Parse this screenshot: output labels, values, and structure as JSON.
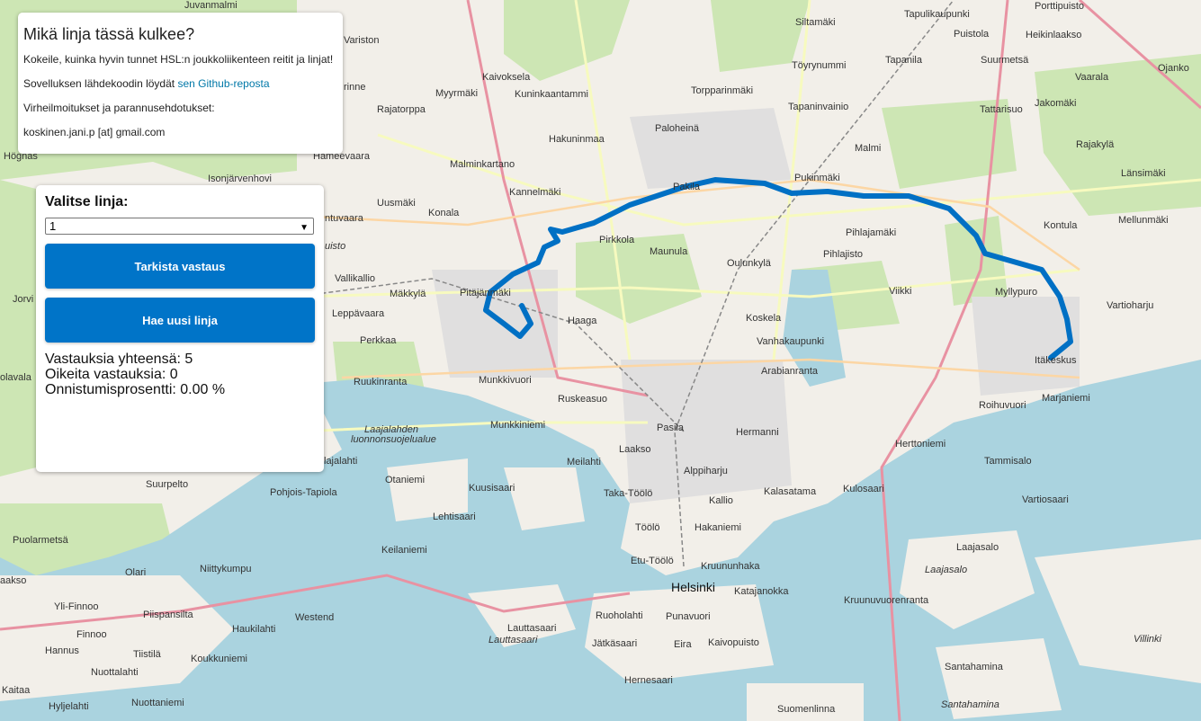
{
  "info": {
    "title": "Mikä linja tässä kulkee?",
    "intro": "Kokeile, kuinka hyvin tunnet HSL:n joukkoliikenteen reitit ja linjat!",
    "source_prefix": "Sovelluksen lähdekoodin löydät ",
    "source_link": "sen Github-reposta",
    "feedback_label": "Virheilmoitukset ja parannusehdotukset:",
    "email": "koskinen.jani.p [at] gmail.com"
  },
  "game": {
    "select_label": "Valitse linja:",
    "selected_line": "1",
    "check_button": "Tarkista vastaus",
    "new_button": "Hae uusi linja",
    "stats": {
      "total": "Vastauksia yhteensä: 5",
      "correct": "Oikeita vastauksia: 0",
      "percent": "Onnistumisprosentti: 0.00 %"
    }
  },
  "map": {
    "route_color": "#0070c4",
    "labels": [
      {
        "id": "juvanmalmi",
        "text": "Juvanmalmi"
      },
      {
        "id": "variston",
        "text": "Variston"
      },
      {
        "id": "kaivoksela",
        "text": "Kaivoksela"
      },
      {
        "id": "myyrmaki",
        "text": "Myyrmäki"
      },
      {
        "id": "kuninkaantammi",
        "text": "Kuninkaantammi"
      },
      {
        "id": "rajatorppa",
        "text": "Rajatorppa"
      },
      {
        "id": "hakuninmaa",
        "text": "Hakuninmaa"
      },
      {
        "id": "malminkartano",
        "text": "Malminkartano"
      },
      {
        "id": "kannelmaki",
        "text": "Kannelmäki"
      },
      {
        "id": "hameevaara",
        "text": "Hämeevaara"
      },
      {
        "id": "uusmaki",
        "text": "Uusmäki"
      },
      {
        "id": "konala",
        "text": "Konala"
      },
      {
        "id": "pirkkola",
        "text": "Pirkkola"
      },
      {
        "id": "maunula",
        "text": "Maunula"
      },
      {
        "id": "pakila",
        "text": "Pakila"
      },
      {
        "id": "paloheina",
        "text": "Paloheinä"
      },
      {
        "id": "torpparinmaki",
        "text": "Torpparinmäki"
      },
      {
        "id": "siltamaki",
        "text": "Siltamäki"
      },
      {
        "id": "tapulikaupunki",
        "text": "Tapulikaupunki"
      },
      {
        "id": "porttipuisto",
        "text": "Porttipuisto"
      },
      {
        "id": "puistola",
        "text": "Puistola"
      },
      {
        "id": "heikinlaakso",
        "text": "Heikinlaakso"
      },
      {
        "id": "toyrynummi",
        "text": "Töyrynummi"
      },
      {
        "id": "tapanila",
        "text": "Tapanila"
      },
      {
        "id": "suurmetsa",
        "text": "Suurmetsä"
      },
      {
        "id": "vaarala",
        "text": "Vaarala"
      },
      {
        "id": "ojanko",
        "text": "Ojanko"
      },
      {
        "id": "tapaninvainio",
        "text": "Tapaninvainio"
      },
      {
        "id": "tattarisuo",
        "text": "Tattarisuo"
      },
      {
        "id": "jakomaki",
        "text": "Jakomäki"
      },
      {
        "id": "malmi",
        "text": "Malmi"
      },
      {
        "id": "rajakyla",
        "text": "Rajakylä"
      },
      {
        "id": "pukinmaki",
        "text": "Pukinmäki"
      },
      {
        "id": "lansimaki",
        "text": "Länsimäki"
      },
      {
        "id": "kontula",
        "text": "Kontula"
      },
      {
        "id": "mellunmaki",
        "text": "Mellunmäki"
      },
      {
        "id": "pihlajamaki",
        "text": "Pihlajamäki"
      },
      {
        "id": "oulunkyla",
        "text": "Oulunkylä"
      },
      {
        "id": "pihlajisto",
        "text": "Pihlajisto"
      },
      {
        "id": "viikki",
        "text": "Viikki"
      },
      {
        "id": "myllypuro",
        "text": "Myllypuro"
      },
      {
        "id": "vartioharju",
        "text": "Vartioharju"
      },
      {
        "id": "itakeskus",
        "text": "Itäkeskus"
      },
      {
        "id": "marjaniemi",
        "text": "Marjaniemi"
      },
      {
        "id": "roihuvuori",
        "text": "Roihuvuori"
      },
      {
        "id": "pitajanmaki",
        "text": "Pitäjänmäki"
      },
      {
        "id": "makkyla",
        "text": "Mäkkylä"
      },
      {
        "id": "vallikallio",
        "text": "Vallikallio"
      },
      {
        "id": "leppavaara",
        "text": "Leppävaara"
      },
      {
        "id": "perkkaa",
        "text": "Perkkaa"
      },
      {
        "id": "ruukinranta",
        "text": "Ruukinranta"
      },
      {
        "id": "haaga",
        "text": "Haaga"
      },
      {
        "id": "koskela",
        "text": "Koskela"
      },
      {
        "id": "vanhakaupunki",
        "text": "Vanhakaupunki"
      },
      {
        "id": "arabianranta",
        "text": "Arabianranta"
      },
      {
        "id": "munkkivuori",
        "text": "Munkkivuori"
      },
      {
        "id": "ruskeasuo",
        "text": "Ruskeasuo"
      },
      {
        "id": "munkkiniemi",
        "text": "Munkkiniemi"
      },
      {
        "id": "pasila",
        "text": "Pasila"
      },
      {
        "id": "hermanni",
        "text": "Hermanni"
      },
      {
        "id": "herttoniemi",
        "text": "Herttoniemi"
      },
      {
        "id": "tammisalo",
        "text": "Tammisalo"
      },
      {
        "id": "laakso",
        "text": "Laakso"
      },
      {
        "id": "meilahti",
        "text": "Meilahti"
      },
      {
        "id": "alppiharju",
        "text": "Alppiharju"
      },
      {
        "id": "kallio",
        "text": "Kallio"
      },
      {
        "id": "kalasatama",
        "text": "Kalasatama"
      },
      {
        "id": "kulosaari",
        "text": "Kulosaari"
      },
      {
        "id": "vartiosaari",
        "text": "Vartiosaari"
      },
      {
        "id": "otaniemi",
        "text": "Otaniemi"
      },
      {
        "id": "kuusisaari",
        "text": "Kuusisaari"
      },
      {
        "id": "takatoolo",
        "text": "Taka-Töölö"
      },
      {
        "id": "toolo",
        "text": "Töölö"
      },
      {
        "id": "hakaniemi",
        "text": "Hakaniemi"
      },
      {
        "id": "suurpelto",
        "text": "Suurpelto"
      },
      {
        "id": "pohjoistapiola",
        "text": "Pohjois-Tapiola"
      },
      {
        "id": "lehtisaari",
        "text": "Lehtisaari"
      },
      {
        "id": "puolarmetsa",
        "text": "Puolarmetsä"
      },
      {
        "id": "keilaniemi",
        "text": "Keilaniemi"
      },
      {
        "id": "etutoolo",
        "text": "Etu-Töölö"
      },
      {
        "id": "kruununhaka",
        "text": "Kruununhaka"
      },
      {
        "id": "laajasalo",
        "text": "Laajasalo"
      },
      {
        "id": "laajasalo2",
        "text": "Laajasalo"
      },
      {
        "id": "olari",
        "text": "Olari"
      },
      {
        "id": "niittykumpu",
        "text": "Niittykumpu"
      },
      {
        "id": "helsinki",
        "text": "Helsinki"
      },
      {
        "id": "katajanokka",
        "text": "Katajanokka"
      },
      {
        "id": "kruunuvuorenranta",
        "text": "Kruunuvuorenranta"
      },
      {
        "id": "ylifinnoo",
        "text": "Yli-Finnoo"
      },
      {
        "id": "piispansilta",
        "text": "Piispansilta"
      },
      {
        "id": "westend",
        "text": "Westend"
      },
      {
        "id": "lauttasaari",
        "text": "Lauttasaari"
      },
      {
        "id": "lauttasaari2",
        "text": "Lauttasaari"
      },
      {
        "id": "ruoholahti",
        "text": "Ruoholahti"
      },
      {
        "id": "punavuori",
        "text": "Punavuori"
      },
      {
        "id": "finnoo",
        "text": "Finnoo"
      },
      {
        "id": "haukilahti",
        "text": "Haukilahti"
      },
      {
        "id": "hannus",
        "text": "Hannus"
      },
      {
        "id": "tiistila",
        "text": "Tiistilä"
      },
      {
        "id": "koukkuniemi",
        "text": "Koukkuniemi"
      },
      {
        "id": "jatkasaari",
        "text": "Jätkäsaari"
      },
      {
        "id": "eira",
        "text": "Eira"
      },
      {
        "id": "kaivopuisto",
        "text": "Kaivopuisto"
      },
      {
        "id": "villinki",
        "text": "Villinki"
      },
      {
        "id": "nuottalahti",
        "text": "Nuottalahti"
      },
      {
        "id": "hernesaari",
        "text": "Hernesaari"
      },
      {
        "id": "santahamina",
        "text": "Santahamina"
      },
      {
        "id": "santahamina2",
        "text": "Santahamina"
      },
      {
        "id": "kaitaa",
        "text": "Kaitaa"
      },
      {
        "id": "hyljelahti",
        "text": "Hyljelahti"
      },
      {
        "id": "nuottaniemi",
        "text": "Nuottaniemi"
      },
      {
        "id": "suomenlinna",
        "text": "Suomenlinna"
      },
      {
        "id": "laajalahden",
        "text": "Laajalahden"
      },
      {
        "id": "luonnonsuojelualue",
        "text": "luonnonsuojelualue"
      },
      {
        "id": "hognas",
        "text": "Högnäs"
      },
      {
        "id": "isonjarvenhovi",
        "text": "Isonjärvenhovi"
      },
      {
        "id": "ntuvaara",
        "text": "ntuvaara"
      },
      {
        "id": "rinne",
        "text": "rinne"
      },
      {
        "id": "jorvi",
        "text": "Jorvi"
      },
      {
        "id": "olavala",
        "text": "olavala"
      },
      {
        "id": "aakso",
        "text": "aakso"
      },
      {
        "id": "lajalahti",
        "text": "lajalahti"
      },
      {
        "id": "uisto",
        "text": "uisto"
      }
    ]
  }
}
